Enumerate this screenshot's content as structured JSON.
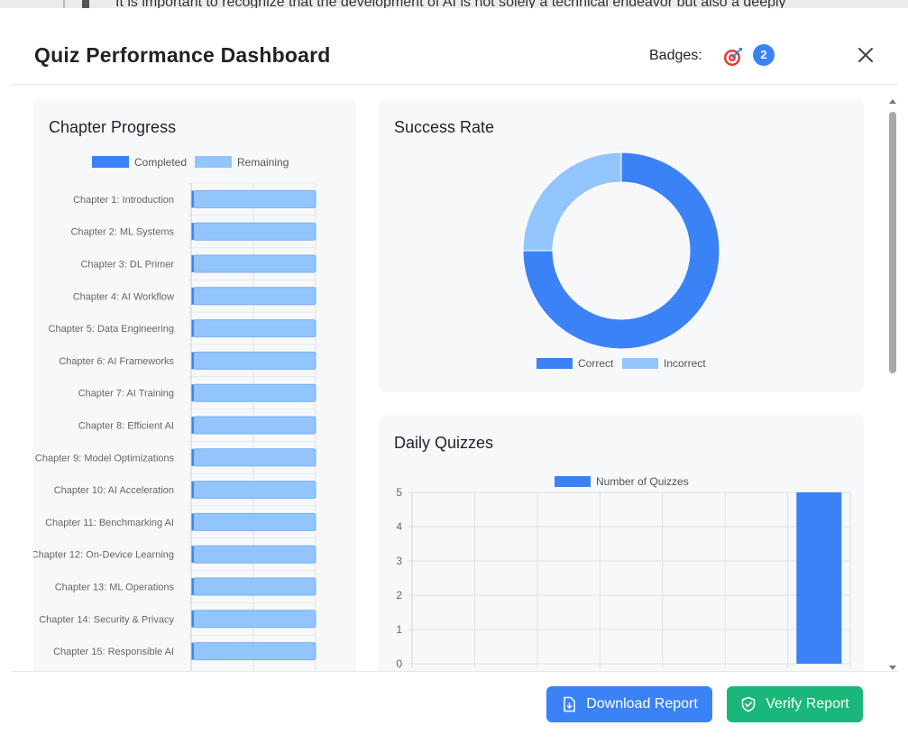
{
  "background_text": "It is important to recognize that the development of AI is not solely a technical endeavor but also a deeply",
  "header": {
    "title": "Quiz Performance Dashboard",
    "badges_label": "Badges:",
    "badge_icon": "target-icon",
    "badge_count": "2",
    "close_icon": "close-icon"
  },
  "colors": {
    "primary": "#3b82f6",
    "primary_light": "#93c5fd",
    "success": "#1ab77a",
    "card_bg": "#f7f8fa"
  },
  "chapter_progress": {
    "title": "Chapter Progress",
    "chart_data": {
      "type": "bar",
      "orientation": "horizontal",
      "stacked": true,
      "categories": [
        "Chapter 1: Introduction",
        "Chapter 2: ML Systems",
        "Chapter 3: DL Primer",
        "Chapter 4: AI Workflow",
        "Chapter 5: Data Engineering",
        "Chapter 6: AI Frameworks",
        "Chapter 7: AI Training",
        "Chapter 8: Efficient AI",
        "Chapter 9: Model Optimizations",
        "Chapter 10: AI Acceleration",
        "Chapter 11: Benchmarking AI",
        "Chapter 12: On-Device Learning",
        "Chapter 13: ML Operations",
        "Chapter 14: Security & Privacy",
        "Chapter 15: Responsible AI"
      ],
      "series": [
        {
          "name": "Completed",
          "values": [
            0.02,
            0.02,
            0.02,
            0.02,
            0.02,
            0.02,
            0.02,
            0.02,
            0.02,
            0.02,
            0.02,
            0.02,
            0.02,
            0.02,
            0.02
          ]
        },
        {
          "name": "Remaining",
          "values": [
            0.98,
            0.98,
            0.98,
            0.98,
            0.98,
            0.98,
            0.98,
            0.98,
            0.98,
            0.98,
            0.98,
            0.98,
            0.98,
            0.98,
            0.98
          ]
        }
      ],
      "xlim": [
        0,
        1
      ],
      "legend": "top",
      "grid": true
    }
  },
  "success_rate": {
    "title": "Success Rate",
    "chart_data": {
      "type": "pie",
      "donut": true,
      "categories": [
        "Correct",
        "Incorrect"
      ],
      "values": [
        75,
        25
      ],
      "legend": "bottom"
    }
  },
  "daily_quizzes": {
    "title": "Daily Quizzes",
    "chart_data": {
      "type": "bar",
      "series": [
        {
          "name": "Number of Quizzes",
          "values": [
            0,
            0,
            0,
            0,
            0,
            0,
            5
          ]
        }
      ],
      "ylim": [
        0,
        5
      ],
      "yticks": [
        "0",
        "1",
        "2",
        "3",
        "4",
        "5"
      ],
      "legend": "top",
      "grid": true
    }
  },
  "footer": {
    "download_label": "Download Report",
    "verify_label": "Verify Report"
  }
}
